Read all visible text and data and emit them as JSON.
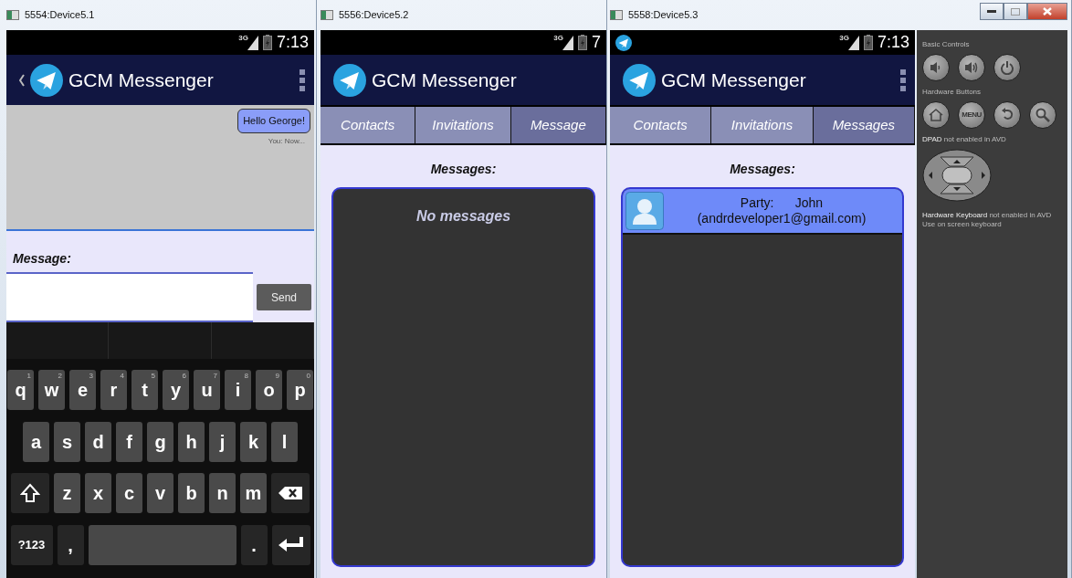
{
  "windows": [
    {
      "kind": "chat",
      "title": "5554:Device5.1",
      "network": "3G",
      "time": "7:13",
      "up_button": true,
      "notification": false,
      "app_title": "GCM Messenger",
      "messages": [
        {
          "text": "Hello George!",
          "meta": "You: Now..."
        }
      ],
      "compose": {
        "label": "Message:",
        "button": "Send"
      },
      "keyboard": {
        "rows": [
          {
            "keys": [
              {
                "kind": "letter",
                "label": "q",
                "hint": "1"
              },
              {
                "kind": "letter",
                "label": "w",
                "hint": "2"
              },
              {
                "kind": "letter",
                "label": "e",
                "hint": "3"
              },
              {
                "kind": "letter",
                "label": "r",
                "hint": "4"
              },
              {
                "kind": "letter",
                "label": "t",
                "hint": "5"
              },
              {
                "kind": "letter",
                "label": "y",
                "hint": "6"
              },
              {
                "kind": "letter",
                "label": "u",
                "hint": "7"
              },
              {
                "kind": "letter",
                "label": "i",
                "hint": "8"
              },
              {
                "kind": "letter",
                "label": "o",
                "hint": "9"
              },
              {
                "kind": "letter",
                "label": "p",
                "hint": "0"
              }
            ]
          },
          {
            "keys": [
              {
                "kind": "letter",
                "label": "a"
              },
              {
                "kind": "letter",
                "label": "s"
              },
              {
                "kind": "letter",
                "label": "d"
              },
              {
                "kind": "letter",
                "label": "f"
              },
              {
                "kind": "letter",
                "label": "g"
              },
              {
                "kind": "letter",
                "label": "h"
              },
              {
                "kind": "letter",
                "label": "j"
              },
              {
                "kind": "letter",
                "label": "k"
              },
              {
                "kind": "letter",
                "label": "l"
              }
            ]
          },
          {
            "keys": [
              {
                "kind": "shift"
              },
              {
                "kind": "letter",
                "label": "z"
              },
              {
                "kind": "letter",
                "label": "x"
              },
              {
                "kind": "letter",
                "label": "c"
              },
              {
                "kind": "letter",
                "label": "v"
              },
              {
                "kind": "letter",
                "label": "b"
              },
              {
                "kind": "letter",
                "label": "n"
              },
              {
                "kind": "letter",
                "label": "m"
              },
              {
                "kind": "delete"
              }
            ]
          },
          {
            "keys": [
              {
                "kind": "symbols",
                "label": "?123"
              },
              {
                "kind": "punct",
                "label": ","
              },
              {
                "kind": "space"
              },
              {
                "kind": "punct",
                "label": "."
              },
              {
                "kind": "enter"
              }
            ]
          }
        ]
      }
    },
    {
      "kind": "list",
      "title": "5556:Device5.2",
      "network": "3G",
      "time": "7",
      "up_button": false,
      "notification": false,
      "overflow_menu": false,
      "app_title": "GCM Messenger",
      "tabs": [
        {
          "label": "Contacts",
          "selected": false
        },
        {
          "label": "Invitations",
          "selected": false
        },
        {
          "label": "Message",
          "selected": true
        }
      ],
      "heading": "Messages:",
      "empty_text": "No messages"
    },
    {
      "kind": "list",
      "title": "5558:Device5.3",
      "network": "3G",
      "time": "7:13",
      "up_button": false,
      "notification": true,
      "overflow_menu": true,
      "app_title": "GCM Messenger",
      "tabs": [
        {
          "label": "Contacts",
          "selected": false
        },
        {
          "label": "Invitations",
          "selected": false
        },
        {
          "label": "Messages",
          "selected": true
        }
      ],
      "heading": "Messages:",
      "items": [
        {
          "party_label": "Party:",
          "name": "John",
          "email": "(andrdeveloper1@gmail.com)"
        }
      ]
    }
  ],
  "controls": {
    "sections": [
      {
        "kind": "buttons",
        "title": "Basic Controls",
        "buttons": [
          {
            "kind": "volume_down"
          },
          {
            "kind": "volume_up"
          },
          {
            "kind": "power"
          }
        ]
      },
      {
        "kind": "buttons",
        "title": "Hardware Buttons",
        "buttons": [
          {
            "kind": "home"
          },
          {
            "kind": "menu",
            "label": "MENU"
          },
          {
            "kind": "back"
          },
          {
            "kind": "search"
          }
        ]
      },
      {
        "kind": "dpad",
        "title": "**DPAD** not enabled in AVD"
      }
    ],
    "notes": [
      "**Hardware Keyboard** not enabled in AVD",
      "Use on screen keyboard"
    ]
  }
}
